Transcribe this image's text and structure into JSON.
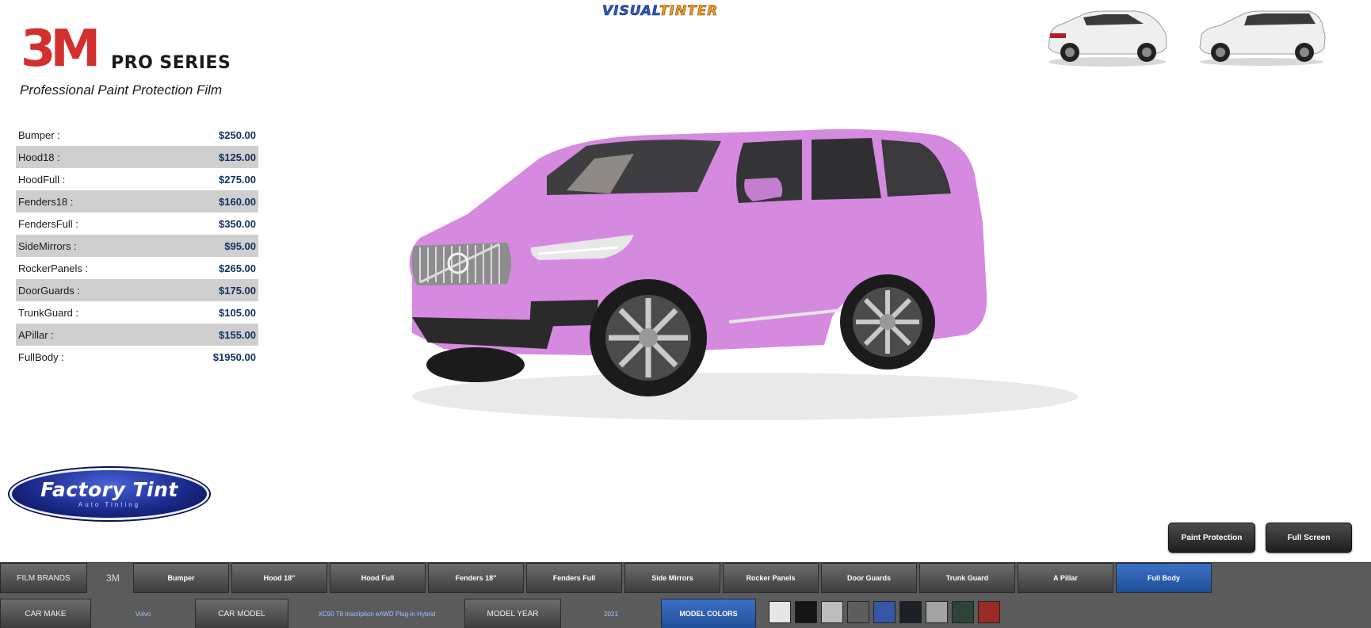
{
  "header": {
    "brand_logo_text": "3M",
    "series_text": "PRO SERIES",
    "subtitle": "Professional Paint Protection Film",
    "app_logo": {
      "part1": "VISUAL",
      "part2": "TINTER"
    }
  },
  "prices": [
    {
      "label": "Bumper :",
      "value": "$250.00"
    },
    {
      "label": "Hood18 :",
      "value": "$125.00"
    },
    {
      "label": "HoodFull :",
      "value": "$275.00"
    },
    {
      "label": "Fenders18 :",
      "value": "$160.00"
    },
    {
      "label": "FendersFull :",
      "value": "$350.00"
    },
    {
      "label": "SideMirrors :",
      "value": "$95.00"
    },
    {
      "label": "RockerPanels :",
      "value": "$265.00"
    },
    {
      "label": "DoorGuards :",
      "value": "$175.00"
    },
    {
      "label": "TrunkGuard :",
      "value": "$105.00"
    },
    {
      "label": "APillar :",
      "value": "$155.00"
    },
    {
      "label": "FullBody :",
      "value": "$1950.00"
    }
  ],
  "installer_logo": {
    "main": "Factory Tint",
    "sub": "Auto Tinting"
  },
  "car": {
    "film_color": "#d58ae0",
    "thumb_color": "#efefef"
  },
  "overlay_buttons": {
    "paint_protection": "Paint Protection",
    "full_screen": "Full Screen"
  },
  "toolbar": {
    "film_brands_label": "FILM BRANDS",
    "brand_value": "3M",
    "areas": [
      "Bumper",
      "Hood 18\"",
      "Hood Full",
      "Fenders 18\"",
      "Fenders Full",
      "Side Mirrors",
      "Rocker Panels",
      "Door Guards",
      "Trunk Guard",
      "A Pillar",
      "Full Body"
    ],
    "active_area": "Full Body",
    "car_make_label": "CAR MAKE",
    "car_make_value": "Volvo",
    "car_model_label": "CAR MODEL",
    "car_model_value": "XC90 T8 Inscription eAWD Plug-in Hybrid",
    "model_year_label": "MODEL YEAR",
    "model_year_value": "2021",
    "model_colors_label": "MODEL COLORS",
    "swatches": [
      "#e6e6e6",
      "#151515",
      "#bdbdbd",
      "#5d5d5d",
      "#3657a8",
      "#1c1f26",
      "#a3a3a3",
      "#2e4438",
      "#9a2a24"
    ]
  }
}
